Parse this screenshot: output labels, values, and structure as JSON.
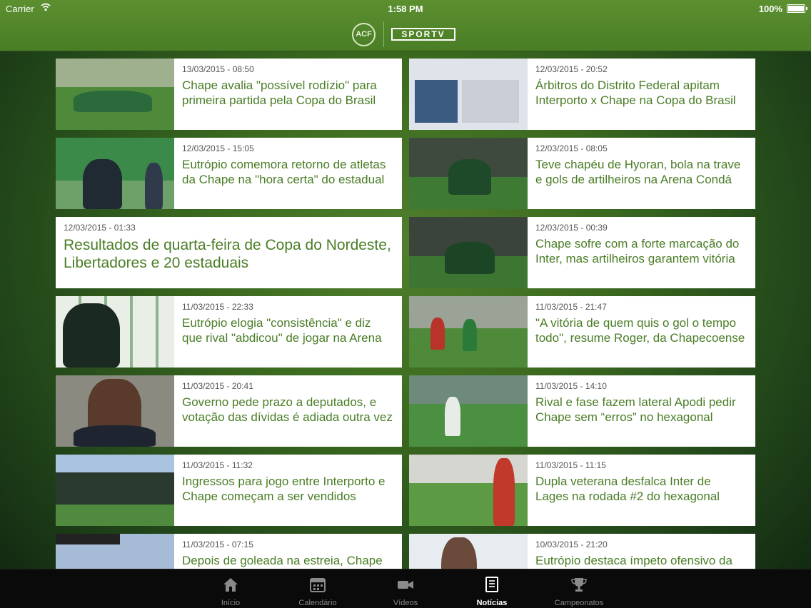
{
  "status_bar": {
    "carrier": "Carrier",
    "time": "1:58 PM",
    "battery": "100%"
  },
  "header": {
    "club_logo_text": "ACF",
    "brand": "SPORTV"
  },
  "news": [
    {
      "date": "13/03/2015 - 08:50",
      "title": "Chape avalia \"possível rodízio\" para primeira partida pela Copa do Brasil"
    },
    {
      "date": "12/03/2015 - 20:52",
      "title": "Árbitros do Distrito Federal apitam Interporto x Chape na Copa do Brasil"
    },
    {
      "date": "12/03/2015 - 15:05",
      "title": "Eutrópio comemora retorno de atletas da Chape na \"hora certa\" do estadual"
    },
    {
      "date": "12/03/2015 - 08:05",
      "title": "Teve chapéu de Hyoran, bola na trave e gols de artilheiros na Arena Condá"
    },
    {
      "date": "12/03/2015 - 01:33",
      "title": "Resultados de quarta-feira de Copa do Nordeste, Libertadores e 20 estaduais"
    },
    {
      "date": "12/03/2015 - 00:39",
      "title": "Chape sofre com a forte marcação do Inter, mas artilheiros garantem vitória"
    },
    {
      "date": "11/03/2015 - 22:33",
      "title": "Eutrópio elogia \"consistência\" e diz que rival \"abdicou\" de jogar na Arena"
    },
    {
      "date": "11/03/2015 - 21:47",
      "title": "\"A vitória de quem quis o gol o tempo todo\", resume Roger, da Chapecoense"
    },
    {
      "date": "11/03/2015 - 20:41",
      "title": "Governo pede prazo a deputados, e votação das dívidas é adiada outra vez"
    },
    {
      "date": "11/03/2015 - 14:10",
      "title": "Rival e fase fazem lateral Apodi pedir Chape sem “erros” no hexagonal"
    },
    {
      "date": "11/03/2015 - 11:32",
      "title": "Ingressos para jogo entre Interporto e Chape começam a ser vendidos"
    },
    {
      "date": "11/03/2015 - 11:15",
      "title": "Dupla veterana desfalca Inter de Lages na rodada #2 do hexagonal"
    },
    {
      "date": "11/03/2015 - 07:15",
      "title": "Depois de goleada na estreia, Chape"
    },
    {
      "date": "10/03/2015 - 21:20",
      "title": "Eutrópio destaca ímpeto ofensivo da"
    }
  ],
  "tabbar": {
    "tabs": [
      {
        "label": "Início",
        "icon": "home-icon"
      },
      {
        "label": "Calendário",
        "icon": "calendar-icon"
      },
      {
        "label": "Vídeos",
        "icon": "video-camera-icon"
      },
      {
        "label": "Notícias",
        "icon": "news-document-icon",
        "active": true
      },
      {
        "label": "Campeonatos",
        "icon": "trophy-icon"
      }
    ]
  },
  "colors": {
    "accent_green": "#4a7d26",
    "header_green": "#5c8f2f",
    "tabbar_bg": "#0a0a0a"
  }
}
